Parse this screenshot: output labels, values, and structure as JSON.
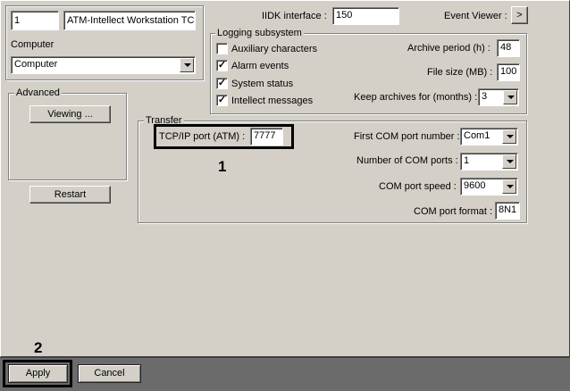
{
  "computer": {
    "id_value": "1",
    "name_value": "ATM-Intellect Workstation TC",
    "label": "Computer",
    "dropdown_value": "Computer"
  },
  "advanced": {
    "title": "Advanced",
    "viewing_label": "Viewing ...",
    "restart_label": "Restart"
  },
  "iidk": {
    "label": "IIDK interface :",
    "value": "150",
    "event_viewer_label": "Event Viewer :",
    "event_viewer_button": ">"
  },
  "logging": {
    "title": "Logging subsystem",
    "checkboxes": [
      {
        "label": "Auxiliary characters",
        "checked": false
      },
      {
        "label": "Alarm events",
        "checked": true
      },
      {
        "label": "System status",
        "checked": true
      },
      {
        "label": "Intellect messages",
        "checked": true
      }
    ],
    "archive_period_label": "Archive period (h) :",
    "archive_period_value": "48",
    "file_size_label": "File size (MB) :",
    "file_size_value": "100",
    "keep_archives_label": "Keep archives for (months) :",
    "keep_archives_value": "3"
  },
  "transfer": {
    "title": "Transfer",
    "tcp_label": "TCP/IP port (ATM) :",
    "tcp_value": "7777",
    "first_com_label": "First COM port number :",
    "first_com_value": "Com1",
    "num_com_label": "Number of COM ports :",
    "num_com_value": "1",
    "com_speed_label": "COM port speed :",
    "com_speed_value": "9600",
    "com_format_label": "COM port format :",
    "com_format_value": "8N1"
  },
  "callouts": {
    "one": "1",
    "two": "2"
  },
  "footer": {
    "apply_label": "Apply",
    "cancel_label": "Cancel"
  },
  "check_glyph": "✓"
}
